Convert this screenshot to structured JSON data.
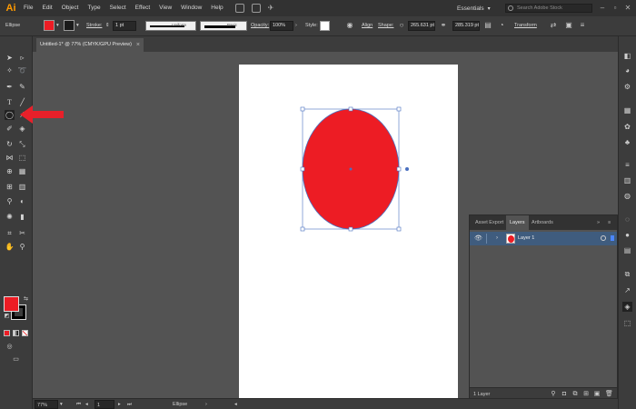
{
  "menubar": {
    "app_logo": "Ai",
    "items": [
      "File",
      "Edit",
      "Object",
      "Type",
      "Select",
      "Effect",
      "View",
      "Window",
      "Help"
    ],
    "workspace": "Essentials",
    "search_placeholder": "Search Adobe Stock"
  },
  "controlbar": {
    "selection_label": "Ellipse",
    "fill_color": "#ed1c24",
    "stroke_label": "Stroke:",
    "stroke_weight": "1 pt",
    "stroke_profile": "Uniform",
    "brush_label": "Basic",
    "opacity_label": "Opacity:",
    "opacity_value": "100%",
    "style_label": "Style:",
    "align_label": "Align",
    "shape_label": "Shape:",
    "width_value": "265.631 pt",
    "height_value": "285.319 pt",
    "transform_label": "Transform"
  },
  "document": {
    "tab_title": "Untitled-1* @ 77% (CMYK/GPU Preview)"
  },
  "artwork": {
    "ellipse_fill": "#ed1c24",
    "selection_color": "#4a6fbf"
  },
  "annotation": {
    "arrow_color": "#e8202a"
  },
  "layers_panel": {
    "tabs": [
      "Asset Export",
      "Layers",
      "Artboards"
    ],
    "active_tab": "Layers",
    "layer_name": "Layer 1",
    "layer_count": "1 Layer"
  },
  "statusbar": {
    "zoom": "77%",
    "artboard_number": "1",
    "current_tool": "Ellipse"
  }
}
